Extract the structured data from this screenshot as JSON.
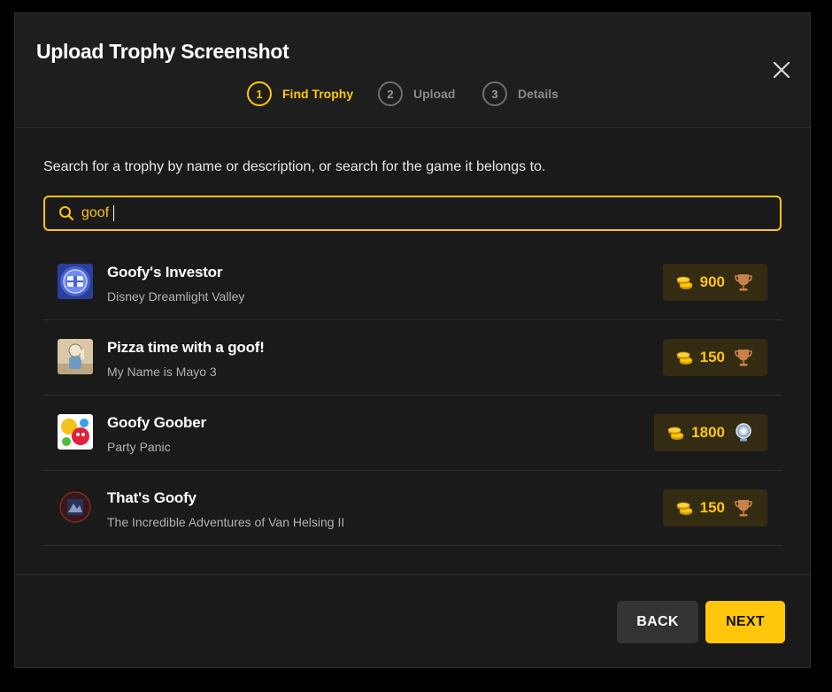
{
  "dialog": {
    "title": "Upload Trophy Screenshot"
  },
  "steps": [
    {
      "number": "1",
      "label": "Find Trophy",
      "active": true
    },
    {
      "number": "2",
      "label": "Upload",
      "active": false
    },
    {
      "number": "3",
      "label": "Details",
      "active": false
    }
  ],
  "intro": "Search for a trophy by name or description, or search for the game it belongs to.",
  "search": {
    "value": "goof"
  },
  "results": [
    {
      "name": "Goofy's Investor",
      "game": "Disney Dreamlight Valley",
      "points": "900",
      "trophy": "bronze",
      "thumb_icon": "dreamlight-chest-icon"
    },
    {
      "name": "Pizza time with a goof!",
      "game": "My Name is Mayo 3",
      "points": "150",
      "trophy": "bronze",
      "thumb_icon": "mayo-character-icon"
    },
    {
      "name": "Goofy Goober",
      "game": "Party Panic",
      "points": "1800",
      "trophy": "platinum",
      "thumb_icon": "party-panic-icon"
    },
    {
      "name": "That's Goofy",
      "game": "The Incredible Adventures of Van Helsing II",
      "points": "150",
      "trophy": "bronze",
      "thumb_icon": "van-helsing-icon"
    }
  ],
  "footer": {
    "back_label": "BACK",
    "next_label": "NEXT"
  },
  "colors": {
    "accent": "#ffc60b",
    "background": "#1a1a1a",
    "points_badge": "#332c12"
  }
}
